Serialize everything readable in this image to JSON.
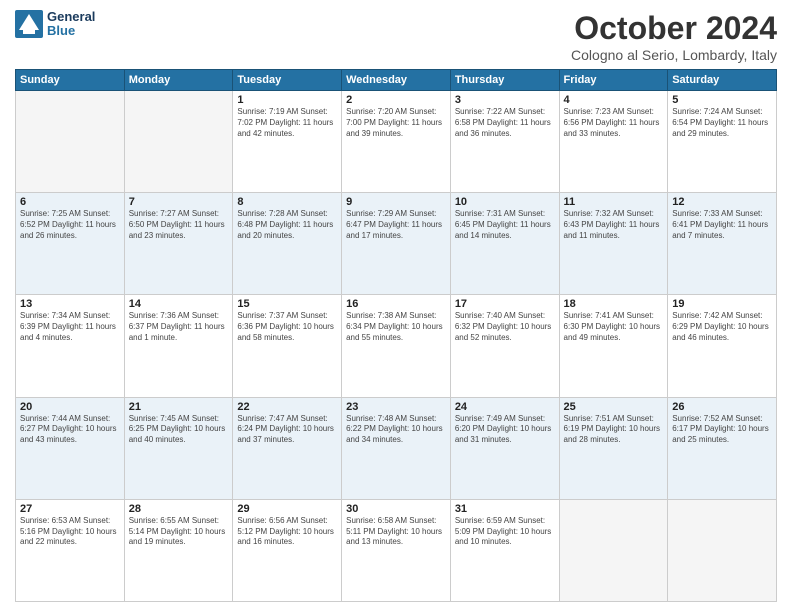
{
  "header": {
    "logo_line1": "General",
    "logo_line2": "Blue",
    "month_title": "October 2024",
    "location": "Cologno al Serio, Lombardy, Italy"
  },
  "days_of_week": [
    "Sunday",
    "Monday",
    "Tuesday",
    "Wednesday",
    "Thursday",
    "Friday",
    "Saturday"
  ],
  "weeks": [
    {
      "shaded": false,
      "days": [
        {
          "number": "",
          "info": ""
        },
        {
          "number": "",
          "info": ""
        },
        {
          "number": "1",
          "info": "Sunrise: 7:19 AM\nSunset: 7:02 PM\nDaylight: 11 hours\nand 42 minutes."
        },
        {
          "number": "2",
          "info": "Sunrise: 7:20 AM\nSunset: 7:00 PM\nDaylight: 11 hours\nand 39 minutes."
        },
        {
          "number": "3",
          "info": "Sunrise: 7:22 AM\nSunset: 6:58 PM\nDaylight: 11 hours\nand 36 minutes."
        },
        {
          "number": "4",
          "info": "Sunrise: 7:23 AM\nSunset: 6:56 PM\nDaylight: 11 hours\nand 33 minutes."
        },
        {
          "number": "5",
          "info": "Sunrise: 7:24 AM\nSunset: 6:54 PM\nDaylight: 11 hours\nand 29 minutes."
        }
      ]
    },
    {
      "shaded": true,
      "days": [
        {
          "number": "6",
          "info": "Sunrise: 7:25 AM\nSunset: 6:52 PM\nDaylight: 11 hours\nand 26 minutes."
        },
        {
          "number": "7",
          "info": "Sunrise: 7:27 AM\nSunset: 6:50 PM\nDaylight: 11 hours\nand 23 minutes."
        },
        {
          "number": "8",
          "info": "Sunrise: 7:28 AM\nSunset: 6:48 PM\nDaylight: 11 hours\nand 20 minutes."
        },
        {
          "number": "9",
          "info": "Sunrise: 7:29 AM\nSunset: 6:47 PM\nDaylight: 11 hours\nand 17 minutes."
        },
        {
          "number": "10",
          "info": "Sunrise: 7:31 AM\nSunset: 6:45 PM\nDaylight: 11 hours\nand 14 minutes."
        },
        {
          "number": "11",
          "info": "Sunrise: 7:32 AM\nSunset: 6:43 PM\nDaylight: 11 hours\nand 11 minutes."
        },
        {
          "number": "12",
          "info": "Sunrise: 7:33 AM\nSunset: 6:41 PM\nDaylight: 11 hours\nand 7 minutes."
        }
      ]
    },
    {
      "shaded": false,
      "days": [
        {
          "number": "13",
          "info": "Sunrise: 7:34 AM\nSunset: 6:39 PM\nDaylight: 11 hours\nand 4 minutes."
        },
        {
          "number": "14",
          "info": "Sunrise: 7:36 AM\nSunset: 6:37 PM\nDaylight: 11 hours\nand 1 minute."
        },
        {
          "number": "15",
          "info": "Sunrise: 7:37 AM\nSunset: 6:36 PM\nDaylight: 10 hours\nand 58 minutes."
        },
        {
          "number": "16",
          "info": "Sunrise: 7:38 AM\nSunset: 6:34 PM\nDaylight: 10 hours\nand 55 minutes."
        },
        {
          "number": "17",
          "info": "Sunrise: 7:40 AM\nSunset: 6:32 PM\nDaylight: 10 hours\nand 52 minutes."
        },
        {
          "number": "18",
          "info": "Sunrise: 7:41 AM\nSunset: 6:30 PM\nDaylight: 10 hours\nand 49 minutes."
        },
        {
          "number": "19",
          "info": "Sunrise: 7:42 AM\nSunset: 6:29 PM\nDaylight: 10 hours\nand 46 minutes."
        }
      ]
    },
    {
      "shaded": true,
      "days": [
        {
          "number": "20",
          "info": "Sunrise: 7:44 AM\nSunset: 6:27 PM\nDaylight: 10 hours\nand 43 minutes."
        },
        {
          "number": "21",
          "info": "Sunrise: 7:45 AM\nSunset: 6:25 PM\nDaylight: 10 hours\nand 40 minutes."
        },
        {
          "number": "22",
          "info": "Sunrise: 7:47 AM\nSunset: 6:24 PM\nDaylight: 10 hours\nand 37 minutes."
        },
        {
          "number": "23",
          "info": "Sunrise: 7:48 AM\nSunset: 6:22 PM\nDaylight: 10 hours\nand 34 minutes."
        },
        {
          "number": "24",
          "info": "Sunrise: 7:49 AM\nSunset: 6:20 PM\nDaylight: 10 hours\nand 31 minutes."
        },
        {
          "number": "25",
          "info": "Sunrise: 7:51 AM\nSunset: 6:19 PM\nDaylight: 10 hours\nand 28 minutes."
        },
        {
          "number": "26",
          "info": "Sunrise: 7:52 AM\nSunset: 6:17 PM\nDaylight: 10 hours\nand 25 minutes."
        }
      ]
    },
    {
      "shaded": false,
      "days": [
        {
          "number": "27",
          "info": "Sunrise: 6:53 AM\nSunset: 5:16 PM\nDaylight: 10 hours\nand 22 minutes."
        },
        {
          "number": "28",
          "info": "Sunrise: 6:55 AM\nSunset: 5:14 PM\nDaylight: 10 hours\nand 19 minutes."
        },
        {
          "number": "29",
          "info": "Sunrise: 6:56 AM\nSunset: 5:12 PM\nDaylight: 10 hours\nand 16 minutes."
        },
        {
          "number": "30",
          "info": "Sunrise: 6:58 AM\nSunset: 5:11 PM\nDaylight: 10 hours\nand 13 minutes."
        },
        {
          "number": "31",
          "info": "Sunrise: 6:59 AM\nSunset: 5:09 PM\nDaylight: 10 hours\nand 10 minutes."
        },
        {
          "number": "",
          "info": ""
        },
        {
          "number": "",
          "info": ""
        }
      ]
    }
  ]
}
